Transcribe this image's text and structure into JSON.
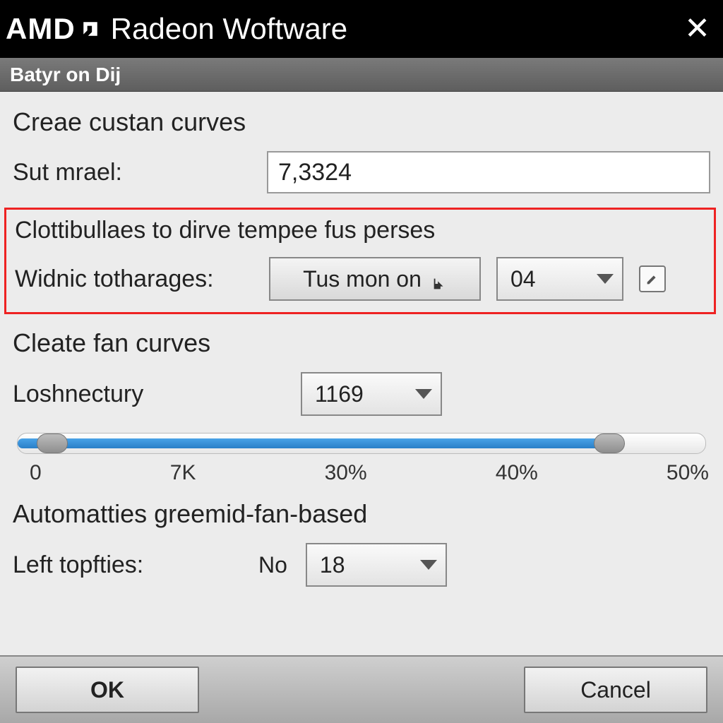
{
  "titlebar": {
    "brand": "AMD",
    "title": "Radeon Woftware"
  },
  "subheader": "Batyr on Dij",
  "section1": {
    "title": "Creae custan curves",
    "field_label": "Sut mrael:",
    "field_value": "7,3324"
  },
  "highlight": {
    "title": "Clottibullaes to dirve tempee fus perses",
    "field_label": "Widnic totharages:",
    "button_label": "Tus mon on",
    "combo_value": "04"
  },
  "section2": {
    "title": "Cleate  fan curves",
    "field_label": "Loshnectury",
    "combo_value": "1169"
  },
  "slider": {
    "fill_percent": 86,
    "thumb_a_percent": 5,
    "thumb_b_percent": 86,
    "ticks": [
      "0",
      "7K",
      "30%",
      "40%",
      "50%"
    ]
  },
  "section3": {
    "title": "Automatties greemid-fan-based",
    "field_label": "Left topfties:",
    "prefix": "No",
    "combo_value": "18"
  },
  "footer": {
    "ok": "OK",
    "cancel": "Cancel"
  }
}
